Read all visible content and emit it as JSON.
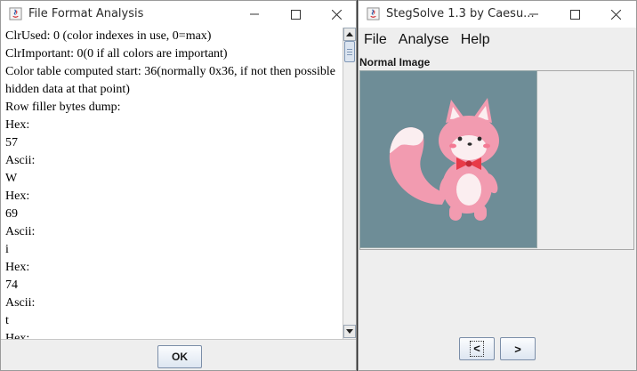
{
  "left_window": {
    "title": "File Format Analysis",
    "lines": [
      "ClrUsed: 0 (color indexes in use, 0=max)",
      "ClrImportant: 0(0 if all colors are important)",
      "Color table computed start: 36(normally 0x36, if not then possible",
      "hidden data at that point)",
      "Row filler bytes dump:",
      "Hex:",
      "57",
      "Ascii:",
      "W",
      "Hex:",
      "69",
      "Ascii:",
      "i",
      "Hex:",
      "74",
      "Ascii:",
      "t",
      "Hex:"
    ],
    "ok_label": "OK"
  },
  "right_window": {
    "title": "StegSolve 1.3 by Caesu...",
    "menu": [
      "File",
      "Analyse",
      "Help"
    ],
    "panel_label": "Normal Image",
    "image": {
      "alt": "cartoon pink fox with red bow tie",
      "background": "#6e8d97"
    },
    "prev_label": "<",
    "next_label": ">"
  },
  "colors": {
    "window_bg": "#ffffff",
    "chrome_bg": "#eeeeee",
    "button_border": "#7b8ea8"
  }
}
